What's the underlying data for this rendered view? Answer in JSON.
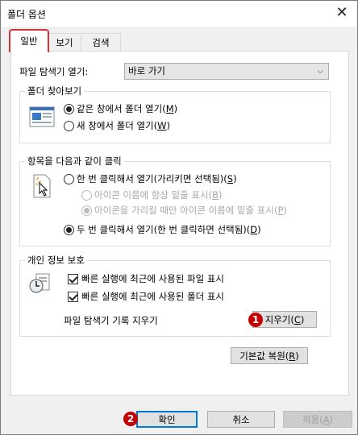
{
  "window": {
    "title": "폴더 옵션",
    "close_glyph": "✕"
  },
  "tabs": [
    {
      "label": "일반",
      "active": true
    },
    {
      "label": "보기",
      "active": false
    },
    {
      "label": "검색",
      "active": false
    }
  ],
  "open_explorer": {
    "label": "파일 탐색기 열기:",
    "selected": "바로 가기"
  },
  "browse_folders": {
    "legend": "폴더 찾아보기",
    "options": [
      {
        "label_prefix": "같은 창에서 폴더 열기(",
        "hotkey": "M",
        "label_suffix": ")",
        "selected": true
      },
      {
        "label_prefix": "새 창에서 폴더 열기(",
        "hotkey": "W",
        "label_suffix": ")",
        "selected": false
      }
    ]
  },
  "click_items": {
    "legend": "항목을 다음과 같이 클릭",
    "single_click": {
      "label_prefix": "한 번 클릭해서 열기(가리키면 선택됨)(",
      "hotkey": "S",
      "label_suffix": ")",
      "selected": false
    },
    "sub_options": [
      {
        "label_prefix": "아이콘 이름에 항상 밑줄 표시(",
        "hotkey": "B",
        "label_suffix": ")",
        "selected": false
      },
      {
        "label_prefix": "아이콘을 가리킬 때만 아이콘 이름에 밑줄 표시(",
        "hotkey": "P",
        "label_suffix": ")",
        "selected": true
      }
    ],
    "double_click": {
      "label_prefix": "두 번 클릭해서 열기(한 번 클릭하면 선택됨)(",
      "hotkey": "D",
      "label_suffix": ")",
      "selected": true
    }
  },
  "privacy": {
    "legend": "개인 정보 보호",
    "checks": [
      {
        "label": "빠른 실행에 최근에 사용된 파일 표시",
        "checked": true
      },
      {
        "label": "빠른 실행에 최근에 사용된 폴더 표시",
        "checked": true
      }
    ],
    "clear_label": "파일 탐색기 기록 지우기",
    "clear_button_prefix": "지우기(",
    "clear_button_hotkey": "C",
    "clear_button_suffix": ")"
  },
  "restore_button": {
    "prefix": "기본값 복원(",
    "hotkey": "R",
    "suffix": ")"
  },
  "footer": {
    "ok": "확인",
    "cancel": "취소",
    "apply_prefix": "적용(",
    "apply_hotkey": "A",
    "apply_suffix": ")"
  },
  "annotations": {
    "badge1": "1",
    "badge2": "2",
    "badge_color": "#c40000"
  }
}
